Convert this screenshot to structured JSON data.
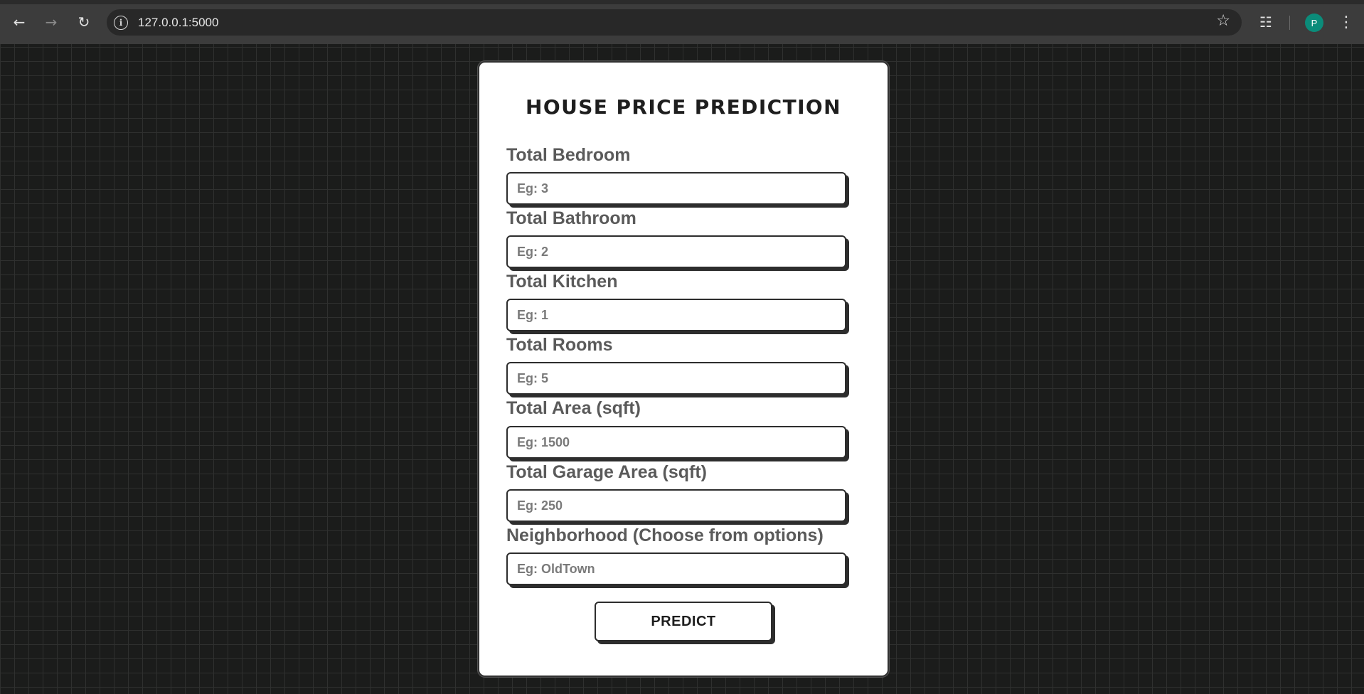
{
  "browser": {
    "url": "127.0.0.1:5000",
    "avatar_initial": "P",
    "icons": {
      "back": "back-arrow-icon",
      "forward": "forward-arrow-icon",
      "reload": "reload-icon",
      "site_info": "info-icon",
      "bookmark": "star-icon",
      "extensions": "puzzle-icon",
      "menu": "kebab-menu-icon"
    },
    "avatar_color": "#0b8c7a"
  },
  "form": {
    "title": "HOUSE PRICE PREDICTION",
    "fields": [
      {
        "label": "Total Bedroom",
        "placeholder": "Eg: 3",
        "value": ""
      },
      {
        "label": "Total Bathroom",
        "placeholder": "Eg: 2",
        "value": ""
      },
      {
        "label": "Total Kitchen",
        "placeholder": "Eg: 1",
        "value": ""
      },
      {
        "label": "Total Rooms",
        "placeholder": "Eg: 5",
        "value": ""
      },
      {
        "label": "Total Area (sqft)",
        "placeholder": "Eg: 1500",
        "value": ""
      },
      {
        "label": "Total Garage Area (sqft)",
        "placeholder": "Eg: 250",
        "value": ""
      },
      {
        "label": "Neighborhood (Choose from options)",
        "placeholder": "Eg: OldTown",
        "value": ""
      }
    ],
    "submit_label": "PREDICT"
  },
  "colors": {
    "page_background": "#1b1c1b",
    "card_background": "#ffffff",
    "label_text": "#5a5a5a",
    "border": "#2d2d2d"
  }
}
